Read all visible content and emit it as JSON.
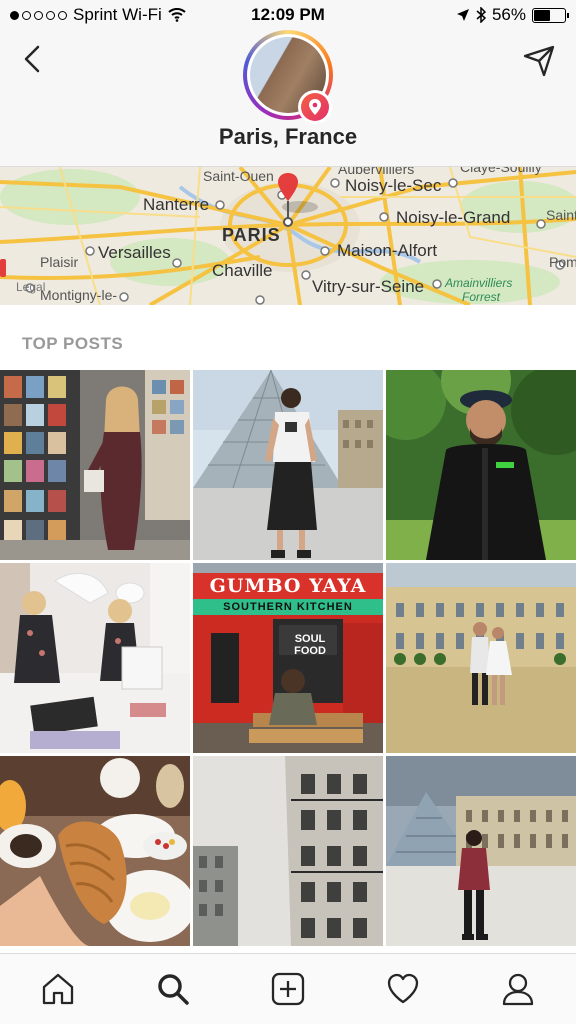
{
  "status_bar": {
    "carrier": "Sprint Wi-Fi",
    "time": "12:09 PM",
    "battery": "56%",
    "battery_level": 0.56
  },
  "header": {
    "title": "Paris, France"
  },
  "map": {
    "labels": {
      "aubervilliers": "Aubervilliers",
      "saint_ouen": "Saint-Ouen",
      "nanterre": "Nanterre",
      "noisy_le_sec": "Noisy-le-Sec",
      "noisy_le_grand": "Noisy-le-Grand",
      "paris": "PARIS",
      "versailles": "Versailles",
      "maison_alfort": "Maison-Alfort",
      "plaisir": "Plaisir",
      "chaville": "Chaville",
      "vitry": "Vitry-sur-Seine",
      "montigny": "Montigny-le-",
      "amainvilliers": "Amainvilliers",
      "forrest": "Forrest",
      "saint_right": "Saint",
      "pom": "Pom",
      "claye": "Claye-Souilly",
      "legal": "Legal"
    }
  },
  "section": {
    "top_posts": "TOP POSTS"
  },
  "posts": [
    {
      "id": "postcard-stand"
    },
    {
      "id": "louvre-pyramid-woman"
    },
    {
      "id": "man-park"
    },
    {
      "id": "pillow-fight"
    },
    {
      "id": "gumbo-yaya",
      "sign": "GUMBO YAYA",
      "sub": "SOUTHERN KITCHEN",
      "window": "SOUL FOOD"
    },
    {
      "id": "elysee-couple"
    },
    {
      "id": "croissant-breakfast"
    },
    {
      "id": "paris-building"
    },
    {
      "id": "louvre-woman"
    }
  ],
  "nav": [
    "home-icon",
    "search-icon",
    "add-post-icon",
    "heart-icon",
    "profile-icon"
  ],
  "colors": {
    "accent_red": "#e1306c",
    "map_road": "#f5c242",
    "map_green": "#cde8b5"
  }
}
